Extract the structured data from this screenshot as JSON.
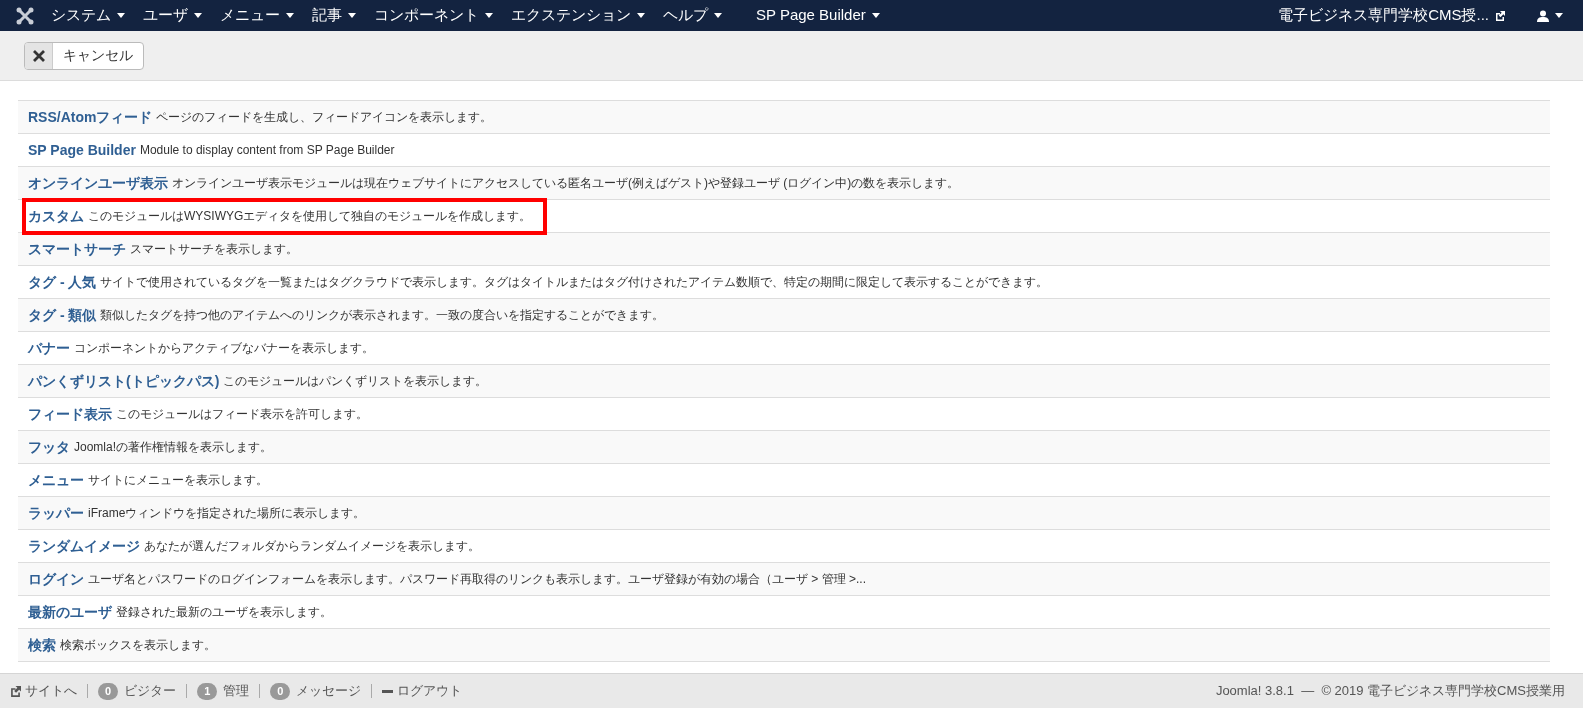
{
  "navbar": {
    "menus": [
      "システム",
      "ユーザ",
      "メニュー",
      "記事",
      "コンポーネント",
      "エクステンション",
      "ヘルプ",
      "SP Page Builder"
    ],
    "site_link": "電子ビジネス専門学校CMS授..."
  },
  "toolbar": {
    "cancel_button": "キャンセル"
  },
  "modules": [
    {
      "title": "RSS/Atomフィード",
      "description": "ページのフィードを生成し、フィードアイコンを表示します。",
      "highlighted": false
    },
    {
      "title": "SP Page Builder",
      "description": "Module to display content from SP Page Builder",
      "highlighted": false
    },
    {
      "title": "オンラインユーザ表示",
      "description": "オンラインユーザ表示モジュールは現在ウェブサイトにアクセスしている匿名ユーザ(例えばゲスト)や登録ユーザ (ログイン中)の数を表示します。",
      "highlighted": false
    },
    {
      "title": "カスタム",
      "description": "このモジュールはWYSIWYGエディタを使用して独自のモジュールを作成します。",
      "highlighted": true
    },
    {
      "title": "スマートサーチ",
      "description": "スマートサーチを表示します。",
      "highlighted": false
    },
    {
      "title": "タグ - 人気",
      "description": "サイトで使用されているタグを一覧またはタグクラウドで表示します。タグはタイトルまたはタグ付けされたアイテム数順で、特定の期間に限定して表示することができます。",
      "highlighted": false
    },
    {
      "title": "タグ - 類似",
      "description": "類似したタグを持つ他のアイテムへのリンクが表示されます。一致の度合いを指定することができます。",
      "highlighted": false
    },
    {
      "title": "バナー",
      "description": "コンポーネントからアクティブなバナーを表示します。",
      "highlighted": false
    },
    {
      "title": "パンくずリスト(トピックパス)",
      "description": "このモジュールはパンくずリストを表示します。",
      "highlighted": false
    },
    {
      "title": "フィード表示",
      "description": "このモジュールはフィード表示を許可します。",
      "highlighted": false
    },
    {
      "title": "フッタ",
      "description": "Joomla!の著作権情報を表示します。",
      "highlighted": false
    },
    {
      "title": "メニュー",
      "description": "サイトにメニューを表示します。",
      "highlighted": false
    },
    {
      "title": "ラッパー",
      "description": "iFrameウィンドウを指定された場所に表示します。",
      "highlighted": false
    },
    {
      "title": "ランダムイメージ",
      "description": "あなたが選んだフォルダからランダムイメージを表示します。",
      "highlighted": false
    },
    {
      "title": "ログイン",
      "description": "ユーザ名とパスワードのログインフォームを表示します。パスワード再取得のリンクも表示します。ユーザ登録が有効の場合（ユーザ > 管理 >...",
      "highlighted": false
    },
    {
      "title": "最新のユーザ",
      "description": "登録された最新のユーザを表示します。",
      "highlighted": false
    },
    {
      "title": "検索",
      "description": "検索ボックスを表示します。",
      "highlighted": false
    }
  ],
  "status_bar": {
    "items": [
      {
        "kind": "link",
        "label": "サイトへ"
      },
      {
        "kind": "count",
        "count": "0",
        "label": "ビジター"
      },
      {
        "kind": "count",
        "count": "1",
        "label": "管理"
      },
      {
        "kind": "count",
        "count": "0",
        "label": "メッセージ"
      },
      {
        "kind": "logout",
        "label": "ログアウト"
      }
    ],
    "copyright": "Joomla! 3.8.1  —  © 2019 電子ビジネス専門学校CMS授業用"
  }
}
